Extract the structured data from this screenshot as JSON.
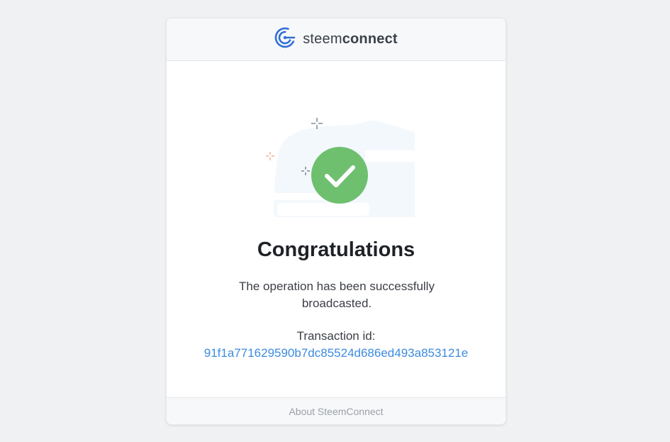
{
  "header": {
    "brand_light": "steem",
    "brand_bold": "connect"
  },
  "main": {
    "title": "Congratulations",
    "message": "The operation has been successfully broadcasted.",
    "transaction_label": "Transaction id:",
    "transaction_id": "91f1a771629590b7dc85524d686ed493a853121e"
  },
  "footer": {
    "about_link": "About SteemConnect"
  },
  "colors": {
    "success": "#6ec06f",
    "link": "#3d8be0",
    "brand": "#2f6fd6"
  }
}
